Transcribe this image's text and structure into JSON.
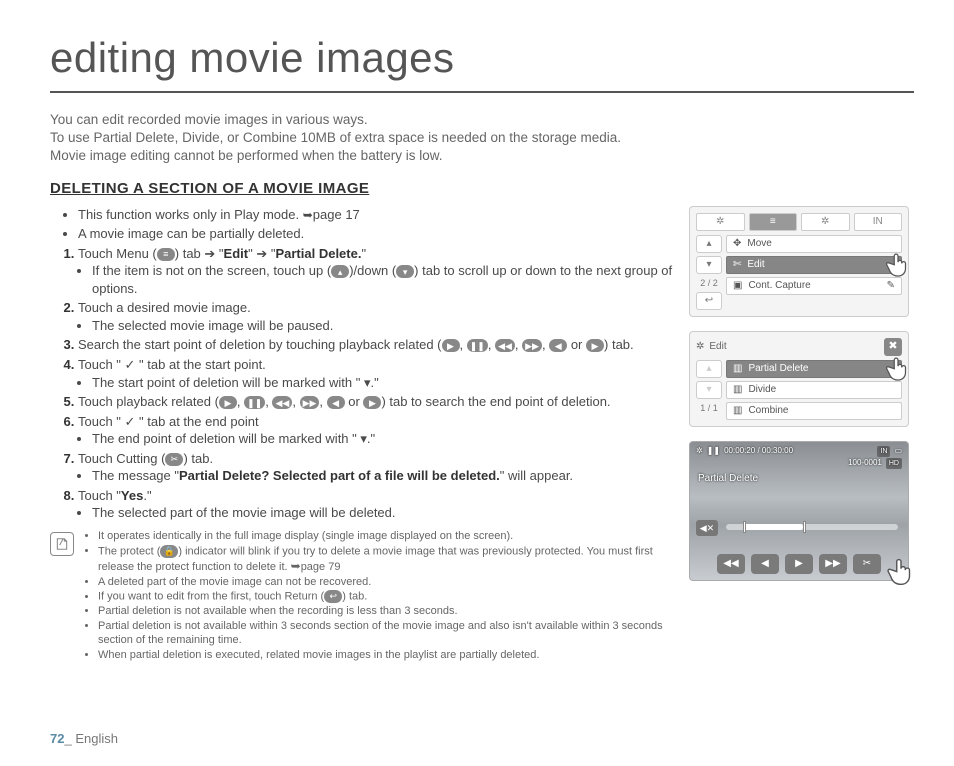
{
  "page_title": "editing movie images",
  "intro": {
    "l1": "You can edit recorded movie images in various ways.",
    "l2": "To use Partial Delete, Divide, or Combine 10MB of extra space is needed on the storage media.",
    "l3": "Movie image editing cannot be performed when the battery is low."
  },
  "section_title": "DELETING A SECTION OF A MOVIE IMAGE",
  "pre_bullets": {
    "b1a": "This function works only in Play mode. ",
    "b1b": "page 17",
    "b2": "A movie image can be partially deleted."
  },
  "steps": {
    "s1": {
      "pre": "Touch Menu (",
      "post": ") tab ",
      "arrow1": "➔",
      "q1": " \"",
      "edit": "Edit",
      "q2": "\" ",
      "arrow2": "➔",
      "q3": " \"",
      "pd": "Partial Delete.",
      "q4": "\""
    },
    "s1sub": {
      "a": "If the item is not on the screen, touch up (",
      "b": ")/down (",
      "c": ") tab to scroll up or down to the next group of options."
    },
    "s2": "Touch a desired movie image.",
    "s2sub": "The selected movie image will be paused.",
    "s3": {
      "a": "Search the start point of deletion by touching playback related (",
      "sep": ", ",
      "or": " or ",
      "end": ") tab."
    },
    "s4": {
      "a": "Touch \" ",
      "check": "✓",
      "b": " \" tab at the start point."
    },
    "s4sub": {
      "a": "The start point of deletion will be marked with \" ",
      "mark": "▾",
      "b": ".\""
    },
    "s5": {
      "a": "Touch playback related (",
      "sep": ", ",
      "or": " or ",
      "end": ") tab to search the end point of deletion."
    },
    "s6": {
      "a": "Touch \" ",
      "check": "✓",
      "b": " \" tab at the end point"
    },
    "s6sub": {
      "a": "The end point of deletion will be marked with \" ",
      "mark": "▾",
      "b": ".\""
    },
    "s7": {
      "a": "Touch Cutting (",
      "b": ") tab."
    },
    "s7sub": {
      "a": "The message \"",
      "msg": "Partial Delete? Selected part of a file will be deleted.",
      "b": "\" will appear."
    },
    "s8": {
      "a": "Touch \"",
      "yes": "Yes",
      "b": ".\""
    },
    "s8sub": "The selected part of the movie image will be deleted."
  },
  "notes": {
    "n1": "It operates identically in the full image display (single image displayed on the screen).",
    "n2": {
      "a": "The protect (",
      "b": ") indicator will blink if you try to delete a movie image that was previously protected. You must first release the protect function to delete it. ",
      "ref": "page 79"
    },
    "n3": "A deleted part of the movie image can not be recovered.",
    "n4": {
      "a": "If you want to edit from the first, touch Return (",
      "b": ") tab."
    },
    "n5": "Partial deletion is not available when the recording is less than 3 seconds.",
    "n6": "Partial deletion is not available within 3 seconds section of the movie image and also isn't available within 3 seconds section of the remaining time.",
    "n7": "When partial deletion is executed, related movie images in the playlist are partially deleted."
  },
  "fig1": {
    "tabs": [
      "≡",
      "✲",
      "IN"
    ],
    "reel": "✲",
    "side": {
      "up": "▴",
      "down": "▾",
      "pager": "2 / 2",
      "back": "↩"
    },
    "rows": {
      "r1": "Move",
      "r2": "Edit",
      "r3": "Cont. Capture"
    },
    "pen": "✎"
  },
  "fig2": {
    "title": "Edit",
    "close": "✖",
    "side": {
      "up": "▴",
      "down": "▾",
      "pager": "1 / 1"
    },
    "rows": {
      "r1": "Partial Delete",
      "r2": "Divide",
      "r3": "Combine"
    }
  },
  "fig3": {
    "pause": "❚❚",
    "time": "00:00:20 / 00:30:00",
    "in": "IN",
    "card": "▭",
    "fileno": "100-0001",
    "hd": "HD",
    "label": "Partial Delete",
    "mute": "◀✕",
    "ctl": {
      "c1": "◀◀",
      "c2": "◀",
      "c3": "▶",
      "c4": "▶▶",
      "c5": "✂"
    }
  },
  "footer": {
    "num": "72",
    "sep": "_",
    "lang": " English"
  }
}
